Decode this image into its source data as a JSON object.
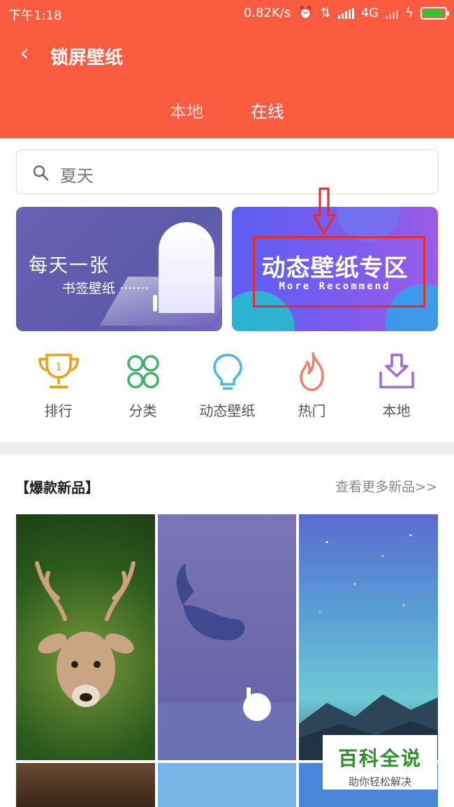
{
  "status_bar": {
    "time": "下午1:18",
    "net_speed": "0.82K/s",
    "network_type": "4G",
    "battery_color": "#33c43a",
    "battery_level": 0.9
  },
  "header": {
    "back_icon": "chevron-left-icon",
    "title": "锁屏壁纸",
    "tabs": [
      {
        "label": "本地",
        "active": false
      },
      {
        "label": "在线",
        "active": true
      }
    ],
    "background": "#fb5c40"
  },
  "search": {
    "icon": "search-icon",
    "placeholder": "夏天"
  },
  "banners": {
    "left": {
      "line1": "每天一张",
      "line2": "书签壁纸 ·······"
    },
    "right": {
      "title": "动态壁纸专区",
      "subtitle": "More Recommend"
    },
    "highlight_color": "#e52b2b"
  },
  "icons": [
    {
      "label": "排行",
      "icon": "trophy-icon",
      "color": "#e8a317"
    },
    {
      "label": "分类",
      "icon": "grid-circles-icon",
      "color": "#3db36a"
    },
    {
      "label": "动态壁纸",
      "icon": "lightbulb-icon",
      "color": "#4cb8e6"
    },
    {
      "label": "热门",
      "icon": "flame-icon",
      "color": "#f0806c"
    },
    {
      "label": "本地",
      "icon": "download-tray-icon",
      "color": "#a467d4"
    }
  ],
  "section": {
    "title": "【爆款新品】",
    "more": "查看更多新品>>"
  },
  "watermark": {
    "main": "百科全说",
    "sub": "助你轻松解决"
  }
}
